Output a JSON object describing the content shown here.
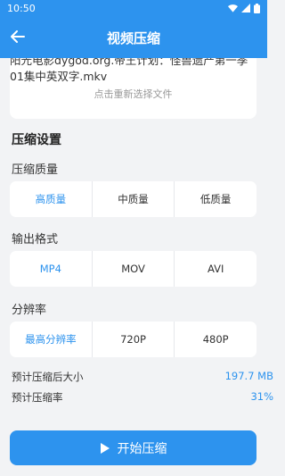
{
  "status_bar": {
    "time": "10:50"
  },
  "app_bar": {
    "title": "视频压缩"
  },
  "file": {
    "name": "阳光电影dygod.org.帝王计划：怪兽遗产第一季01集中英双字.mkv",
    "reselect_hint": "点击重新选择文件"
  },
  "settings": {
    "title": "压缩设置",
    "quality": {
      "label": "压缩质量",
      "options": [
        "高质量",
        "中质量",
        "低质量"
      ],
      "selected": 0
    },
    "format": {
      "label": "输出格式",
      "options": [
        "MP4",
        "MOV",
        "AVI"
      ],
      "selected": 0
    },
    "resolution": {
      "label": "分辨率",
      "options": [
        "最高分辨率",
        "720P",
        "480P"
      ],
      "selected": 0
    }
  },
  "estimate": {
    "size_label": "预计压缩后大小",
    "size_value": "197.7 MB",
    "ratio_label": "预计压缩率",
    "ratio_value": "31%"
  },
  "start_button": {
    "label": "开始压缩"
  },
  "colors": {
    "accent": "#2d93ee",
    "background": "#f2f3f5"
  },
  "icons": [
    "wifi-icon",
    "signal-icon",
    "battery-icon",
    "back-arrow-icon",
    "play-icon"
  ]
}
